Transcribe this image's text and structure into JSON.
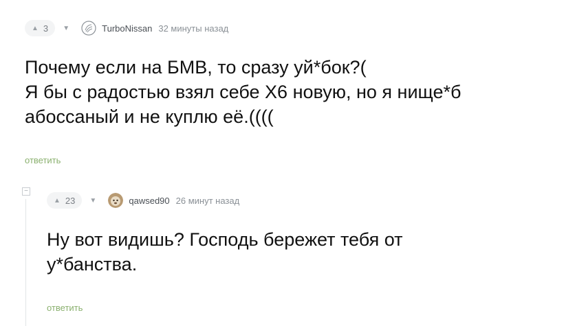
{
  "comment1": {
    "votes": "3",
    "author": "TurboNissan",
    "time": "32 минуты назад",
    "text": "Почему если на БМВ, то сразу уй*бок?(\nЯ бы с радостью взял себе Х6 новую, но я нище*б\nабоссаный и не куплю её.((((",
    "reply_label": "ответить"
  },
  "comment2": {
    "votes": "23",
    "author": "qawsed90",
    "time": "26 минут назад",
    "text": "Ну вот видишь? Господь бережет тебя от\nу*банства.",
    "reply_label": "ответить"
  },
  "collapse_glyph": "−",
  "icons": {
    "upvote": "triangle-up-icon",
    "downvote": "triangle-down-icon",
    "avatar1": "default-avatar-icon",
    "avatar2": "user-avatar-icon"
  },
  "colors": {
    "reply_link": "#8ab06e",
    "vote_bg": "#f3f4f5"
  }
}
